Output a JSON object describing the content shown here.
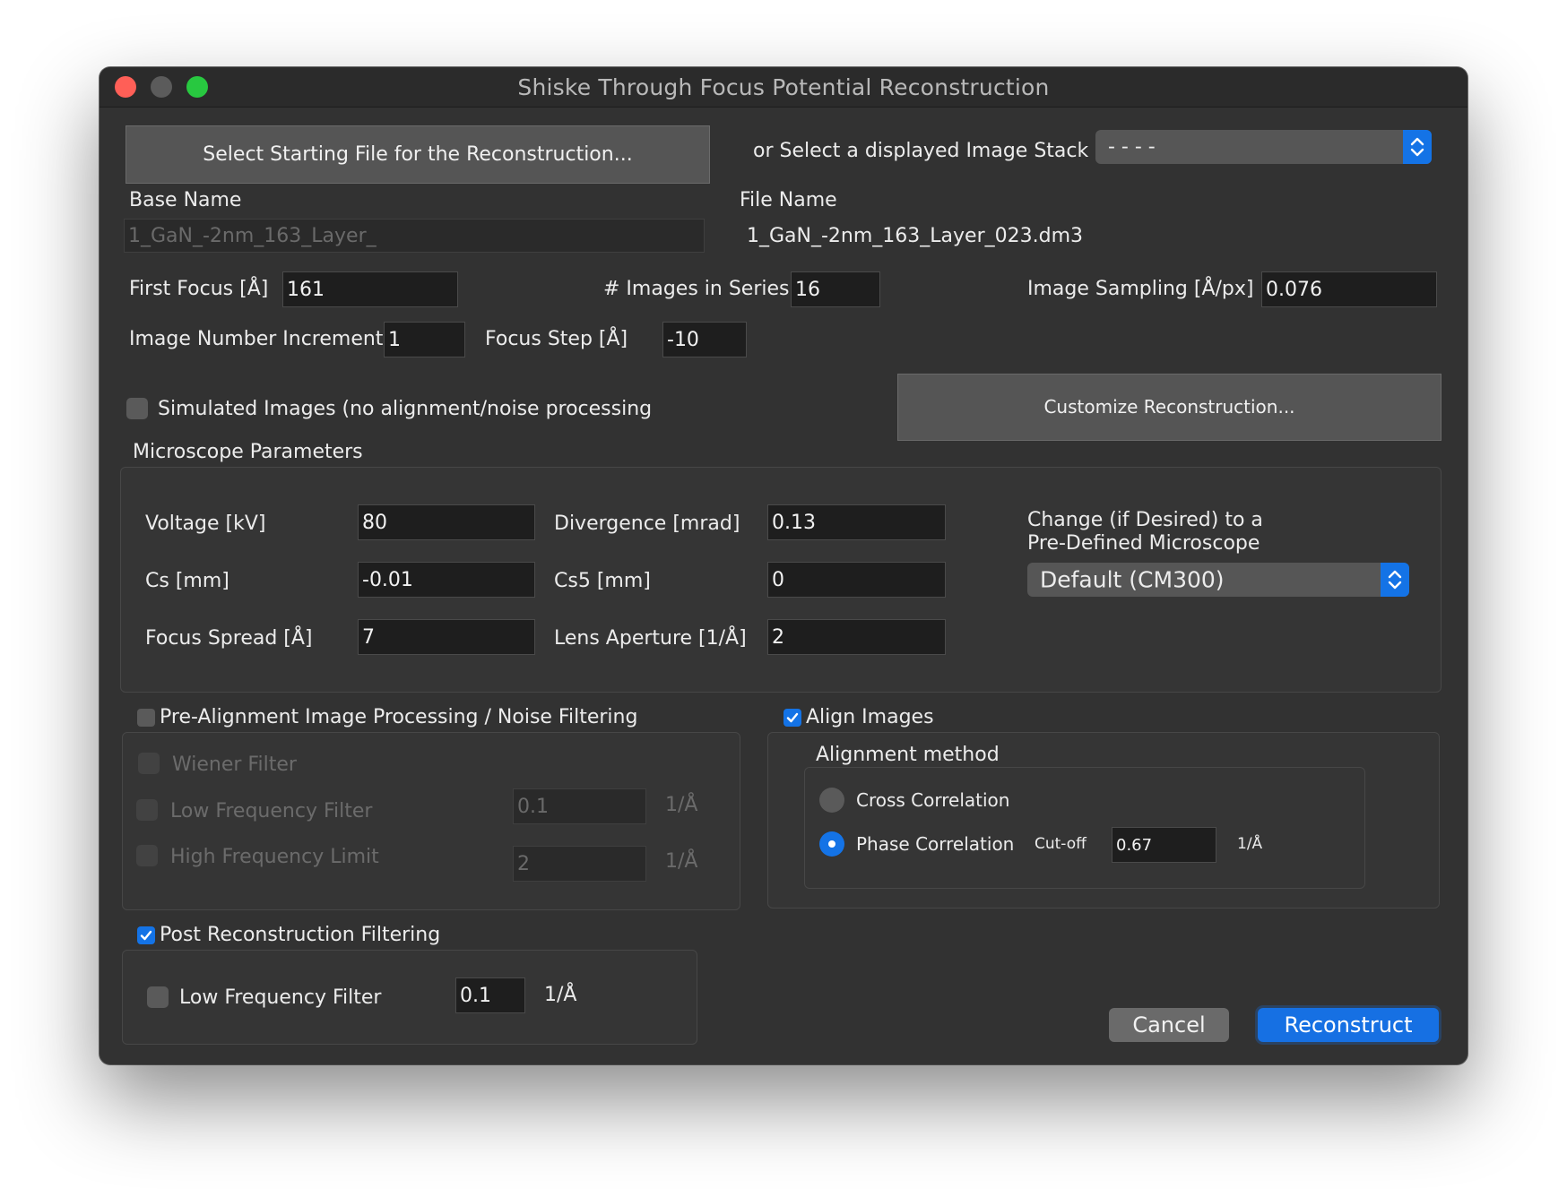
{
  "window": {
    "title": "Shiske Through Focus Potential Reconstruction"
  },
  "file": {
    "select_button": "Select Starting File for the Reconstruction...",
    "stack_label": "or Select a displayed Image Stack",
    "stack_value": "- - - -",
    "base_name_label": "Base Name",
    "base_name_value": "1_GaN_-2nm_163_Layer_",
    "file_name_label": "File Name",
    "file_name_value": "1_GaN_-2nm_163_Layer_023.dm3"
  },
  "series": {
    "first_focus_label": "First Focus [Å]",
    "first_focus_value": "161",
    "images_label": "# Images in Series",
    "images_value": "16",
    "sampling_label": "Image Sampling [Å/px]",
    "sampling_value": "0.076",
    "increment_label": "Image Number Increment",
    "increment_value": "1",
    "focus_step_label": "Focus Step [Å]",
    "focus_step_value": "-10"
  },
  "simulated": {
    "label": "Simulated Images (no alignment/noise processing",
    "checked": false
  },
  "customize_button": "Customize Reconstruction...",
  "microscope": {
    "title": "Microscope Parameters",
    "voltage_label": "Voltage [kV]",
    "voltage_value": "80",
    "divergence_label": "Divergence [mrad]",
    "divergence_value": "0.13",
    "cs_label": "Cs [mm]",
    "cs_value": "-0.01",
    "cs5_label": "Cs5 [mm]",
    "cs5_value": "0",
    "focus_spread_label": "Focus Spread [Å]",
    "focus_spread_value": "7",
    "aperture_label": "Lens Aperture [1/Å]",
    "aperture_value": "2",
    "predefined_label_line1": "Change (if Desired) to a",
    "predefined_label_line2": "Pre-Defined Microscope",
    "predefined_value": "Default (CM300)"
  },
  "prealign": {
    "title": "Pre-Alignment Image Processing / Noise Filtering",
    "checked": false,
    "wiener_label": "Wiener Filter",
    "low_freq_label": "Low Frequency Filter",
    "low_freq_value": "0.1",
    "low_freq_unit": "1/Å",
    "high_freq_label": "High Frequency Limit",
    "high_freq_value": "2",
    "high_freq_unit": "1/Å"
  },
  "align": {
    "title": "Align Images",
    "checked": true,
    "method_label": "Alignment method",
    "cross_label": "Cross Correlation",
    "phase_label": "Phase Correlation",
    "selected": "Phase Correlation",
    "cutoff_label": "Cut-off",
    "cutoff_value": "0.67",
    "cutoff_unit": "1/Å"
  },
  "post": {
    "title": "Post Reconstruction Filtering",
    "checked": true,
    "low_freq_label": "Low Frequency Filter",
    "low_freq_checked": false,
    "low_freq_value": "0.1",
    "low_freq_unit": "1/Å"
  },
  "actions": {
    "cancel": "Cancel",
    "reconstruct": "Reconstruct"
  },
  "colors": {
    "accent": "#1473e6",
    "window_bg": "#323232",
    "close": "#ff5f57",
    "zoom": "#28c840"
  }
}
